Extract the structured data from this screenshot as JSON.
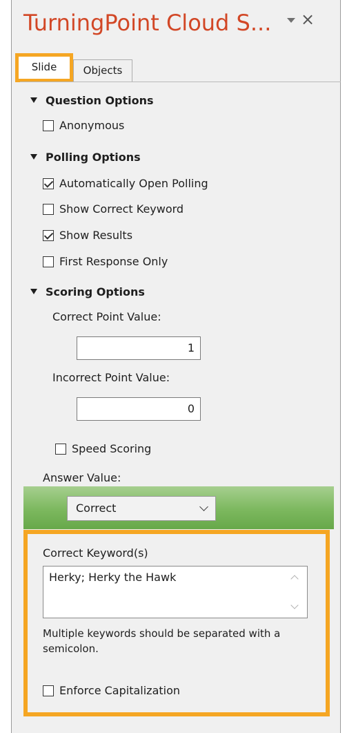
{
  "pane": {
    "title": "TurningPoint Cloud S...",
    "close_glyph": "×"
  },
  "tabs": [
    {
      "label": "Slide"
    },
    {
      "label": "Objects"
    }
  ],
  "question_options": {
    "header": "Question Options",
    "items": [
      {
        "label": "Anonymous",
        "checked": false
      }
    ]
  },
  "polling_options": {
    "header": "Polling Options",
    "items": [
      {
        "label": "Automatically Open Polling",
        "checked": true
      },
      {
        "label": "Show Correct Keyword",
        "checked": false
      },
      {
        "label": "Show Results",
        "checked": true
      },
      {
        "label": "First Response Only",
        "checked": false
      }
    ]
  },
  "scoring_options": {
    "header": "Scoring Options",
    "correct_label": "Correct Point Value:",
    "correct_value": "1",
    "incorrect_label": "Incorrect Point Value:",
    "incorrect_value": "0",
    "speed_scoring": {
      "label": "Speed Scoring",
      "checked": false
    }
  },
  "answer_value": {
    "label": "Answer Value:",
    "selected": "Correct"
  },
  "keywords": {
    "label": "Correct Keyword(s)",
    "value": "Herky; Herky the Hawk",
    "help": "Multiple keywords should be separated with a semicolon.",
    "enforce_capitalization": {
      "label": "Enforce Capitalization",
      "checked": false
    }
  },
  "colors": {
    "title": "#d24726",
    "highlight": "#f5a623",
    "answer_band": "#7cb85e"
  }
}
